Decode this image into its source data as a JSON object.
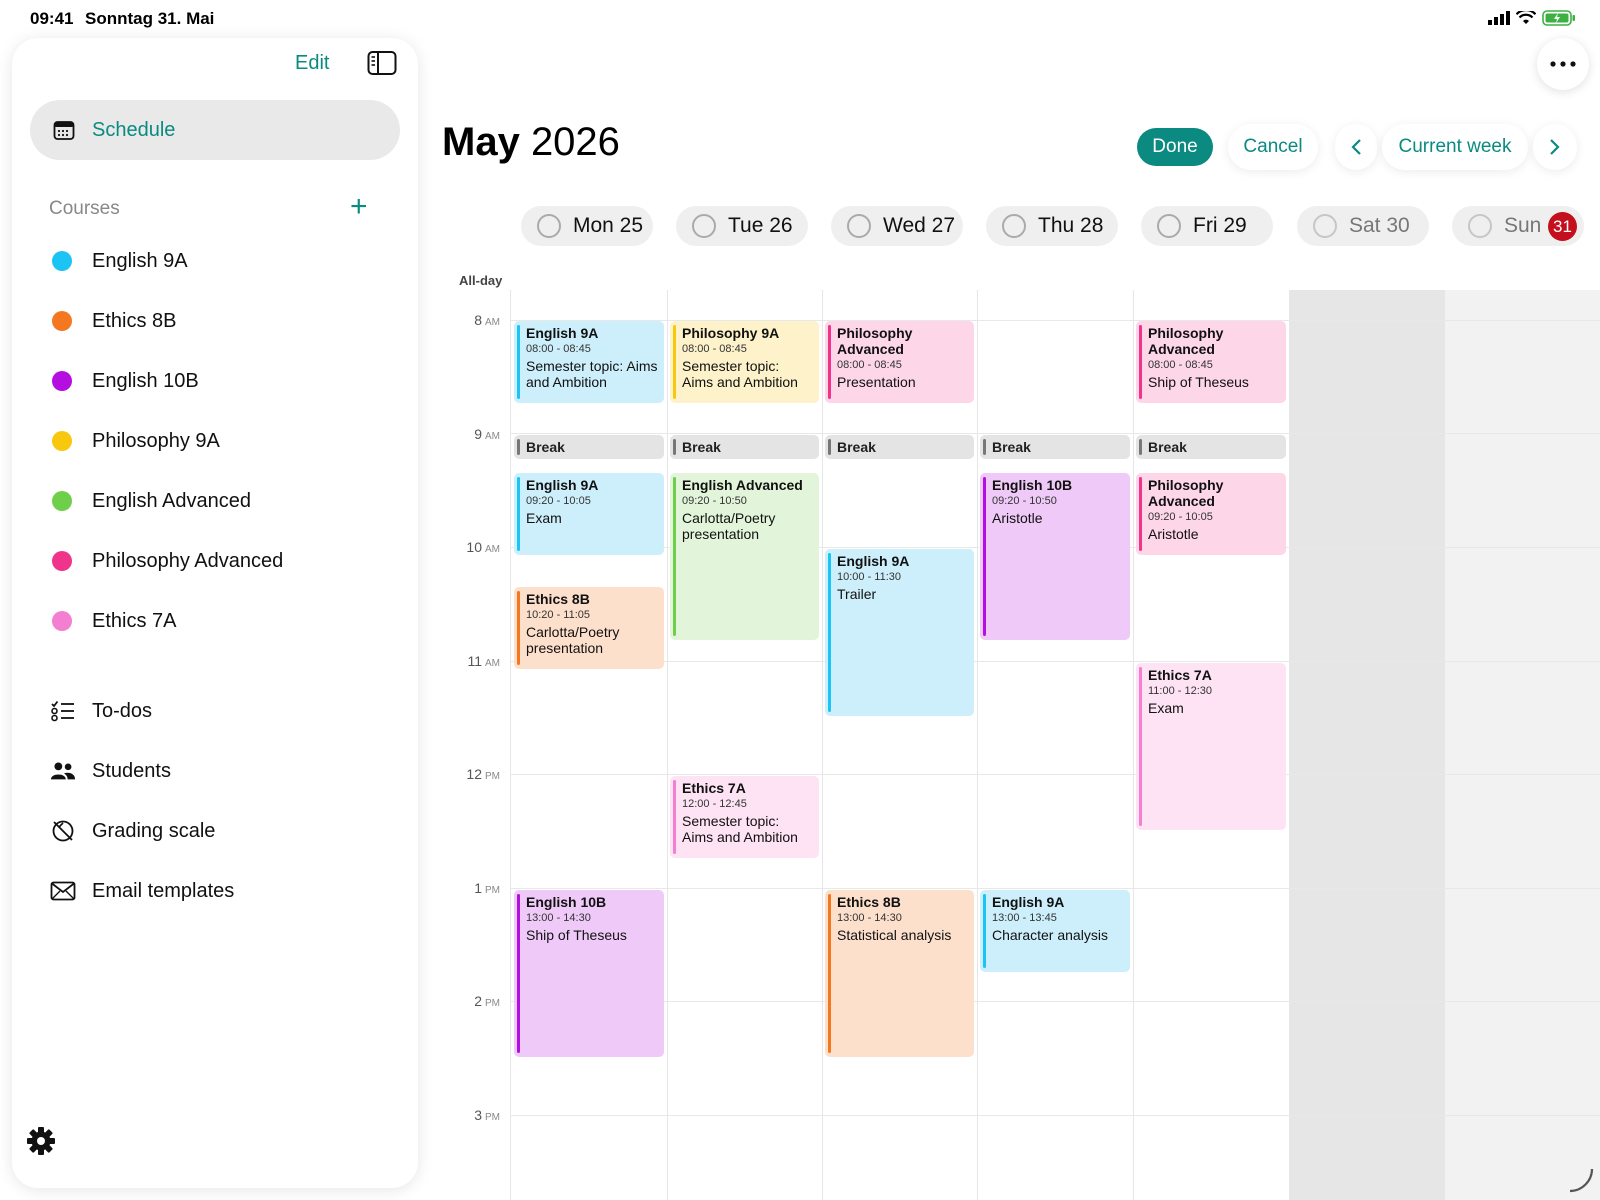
{
  "status": {
    "time": "09:41",
    "date": "Sonntag 31. Mai"
  },
  "sidebar": {
    "edit_label": "Edit",
    "schedule_label": "Schedule",
    "courses_title": "Courses",
    "add_label": "+",
    "courses": [
      {
        "label": "English 9A",
        "color": "#1cc3f5"
      },
      {
        "label": "Ethics 8B",
        "color": "#f4781f"
      },
      {
        "label": "English 10B",
        "color": "#b40ee0"
      },
      {
        "label": "Philosophy 9A",
        "color": "#f7c80d"
      },
      {
        "label": "English Advanced",
        "color": "#6ecf4b"
      },
      {
        "label": "Philosophy Advanced",
        "color": "#f0338b"
      },
      {
        "label": "Ethics 7A",
        "color": "#f47ed0"
      }
    ],
    "nav": [
      {
        "label": "To-dos",
        "icon": "checklist-icon"
      },
      {
        "label": "Students",
        "icon": "people-icon"
      },
      {
        "label": "Grading scale",
        "icon": "grading-scale-icon"
      },
      {
        "label": "Email templates",
        "icon": "envelope-icon"
      }
    ]
  },
  "header": {
    "month": "May",
    "year": "2026",
    "done_label": "Done",
    "cancel_label": "Cancel",
    "prev_label": "‹",
    "week_label": "Current week",
    "next_label": "›"
  },
  "days": [
    {
      "label": "Mon 25"
    },
    {
      "label": "Tue 26"
    },
    {
      "label": "Wed 27"
    },
    {
      "label": "Thu 28"
    },
    {
      "label": "Fri 29"
    },
    {
      "label": "Sat 30"
    },
    {
      "label": "Sun"
    }
  ],
  "today_badge": "31",
  "allday_label": "All-day",
  "hours": [
    {
      "h": "8",
      "ap": "AM"
    },
    {
      "h": "9",
      "ap": "AM"
    },
    {
      "h": "10",
      "ap": "AM"
    },
    {
      "h": "11",
      "ap": "AM"
    },
    {
      "h": "12",
      "ap": "PM"
    },
    {
      "h": "1",
      "ap": "PM"
    },
    {
      "h": "2",
      "ap": "PM"
    },
    {
      "h": "3",
      "ap": "PM"
    }
  ],
  "break_label": "Break",
  "events": [
    {
      "title": "English 9A",
      "time": "08:00 - 08:45",
      "desc": "Semester topic: Aims and Ambition"
    },
    {
      "title": "Philosophy 9A",
      "time": "08:00 - 08:45",
      "desc": "Semester topic: Aims and Ambition"
    },
    {
      "title": "Philosophy Advanced",
      "time": "08:00 - 08:45",
      "desc": "Presentation"
    },
    {
      "title": "Philosophy Advanced",
      "time": "08:00 - 08:45",
      "desc": "Ship of Theseus"
    },
    {
      "title": "English 9A",
      "time": "09:20 - 10:05",
      "desc": "Exam"
    },
    {
      "title": "English Advanced",
      "time": "09:20 - 10:50",
      "desc": "Carlotta/Poetry presentation"
    },
    {
      "title": "English 10B",
      "time": "09:20 - 10:50",
      "desc": "Aristotle"
    },
    {
      "title": "Philosophy Advanced",
      "time": "09:20 - 10:05",
      "desc": "Aristotle"
    },
    {
      "title": "English 9A",
      "time": "10:00 - 11:30",
      "desc": "Trailer"
    },
    {
      "title": "Ethics 8B",
      "time": "10:20 - 11:05",
      "desc": "Carlotta/Poetry presentation"
    },
    {
      "title": "Ethics 7A",
      "time": "11:00 - 12:30",
      "desc": "Exam"
    },
    {
      "title": "Ethics 7A",
      "time": "12:00 - 12:45",
      "desc": "Semester topic: Aims and Ambition"
    },
    {
      "title": "English 10B",
      "time": "13:00 - 14:30",
      "desc": "Ship of Theseus"
    },
    {
      "title": "Ethics 8B",
      "time": "13:00 - 14:30",
      "desc": "Statistical analysis"
    },
    {
      "title": "English 9A",
      "time": "13:00 - 13:45",
      "desc": "Character analysis"
    }
  ],
  "colors": {
    "accent": "#0a8a80",
    "today_badge": "#c40f1c",
    "english9a_bg": "#cdeffb",
    "ethics8b_bg": "#fde0cc",
    "english10b_bg": "#efcaf8",
    "philosophy9a_bg": "#fdf2c9",
    "englishadv_bg": "#e2f5da",
    "philadv_bg": "#fdd6e8",
    "ethics7a_bg": "#fde3f4"
  }
}
